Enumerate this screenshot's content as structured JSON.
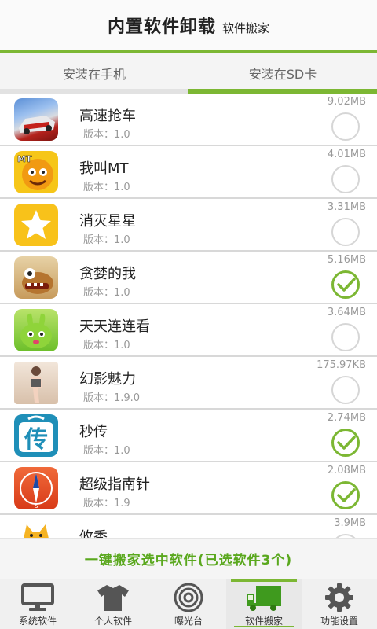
{
  "header": {
    "title": "内置软件卸载",
    "subtitle": "软件搬家"
  },
  "tabs": [
    {
      "label": "安装在手机",
      "active": false
    },
    {
      "label": "安装在SD卡",
      "active": true
    }
  ],
  "apps": [
    {
      "name": "高速抢车",
      "version": "版本：1.0",
      "size": "9.02MB",
      "checked": false,
      "icon": "racing-car-icon"
    },
    {
      "name": "我叫MT",
      "version": "版本：1.0",
      "size": "4.01MB",
      "checked": false,
      "icon": "mt-character-icon"
    },
    {
      "name": "消灭星星",
      "version": "版本：1.0",
      "size": "3.31MB",
      "checked": false,
      "icon": "star-icon"
    },
    {
      "name": "贪婪的我",
      "version": "版本：1.0",
      "size": "5.16MB",
      "checked": true,
      "icon": "greedy-monster-icon"
    },
    {
      "name": "天天连连看",
      "version": "版本：1.0",
      "size": "3.64MB",
      "checked": false,
      "icon": "green-rabbit-icon"
    },
    {
      "name": "幻影魅力",
      "version": "版本：1.9.0",
      "size": "175.97KB",
      "checked": false,
      "icon": "model-photo-icon"
    },
    {
      "name": "秒传",
      "version": "版本：1.0",
      "size": "2.74MB",
      "checked": true,
      "icon": "chuan-transfer-icon"
    },
    {
      "name": "超级指南针",
      "version": "版本：1.9",
      "size": "2.08MB",
      "checked": true,
      "icon": "compass-icon"
    },
    {
      "name": "攸秀",
      "version": "",
      "size": "3.9MB",
      "checked": false,
      "icon": "cat-icon"
    }
  ],
  "action": {
    "label": "一键搬家选中软件(已选软件3个)"
  },
  "nav": [
    {
      "label": "系统软件",
      "icon": "monitor-icon",
      "active": false
    },
    {
      "label": "个人软件",
      "icon": "tshirt-icon",
      "active": false
    },
    {
      "label": "曝光台",
      "icon": "target-icon",
      "active": false
    },
    {
      "label": "软件搬家",
      "icon": "truck-icon",
      "active": true
    },
    {
      "label": "功能设置",
      "icon": "gear-icon",
      "active": false
    }
  ],
  "colors": {
    "accent": "#7cb733",
    "action_text": "#5aa81e"
  }
}
